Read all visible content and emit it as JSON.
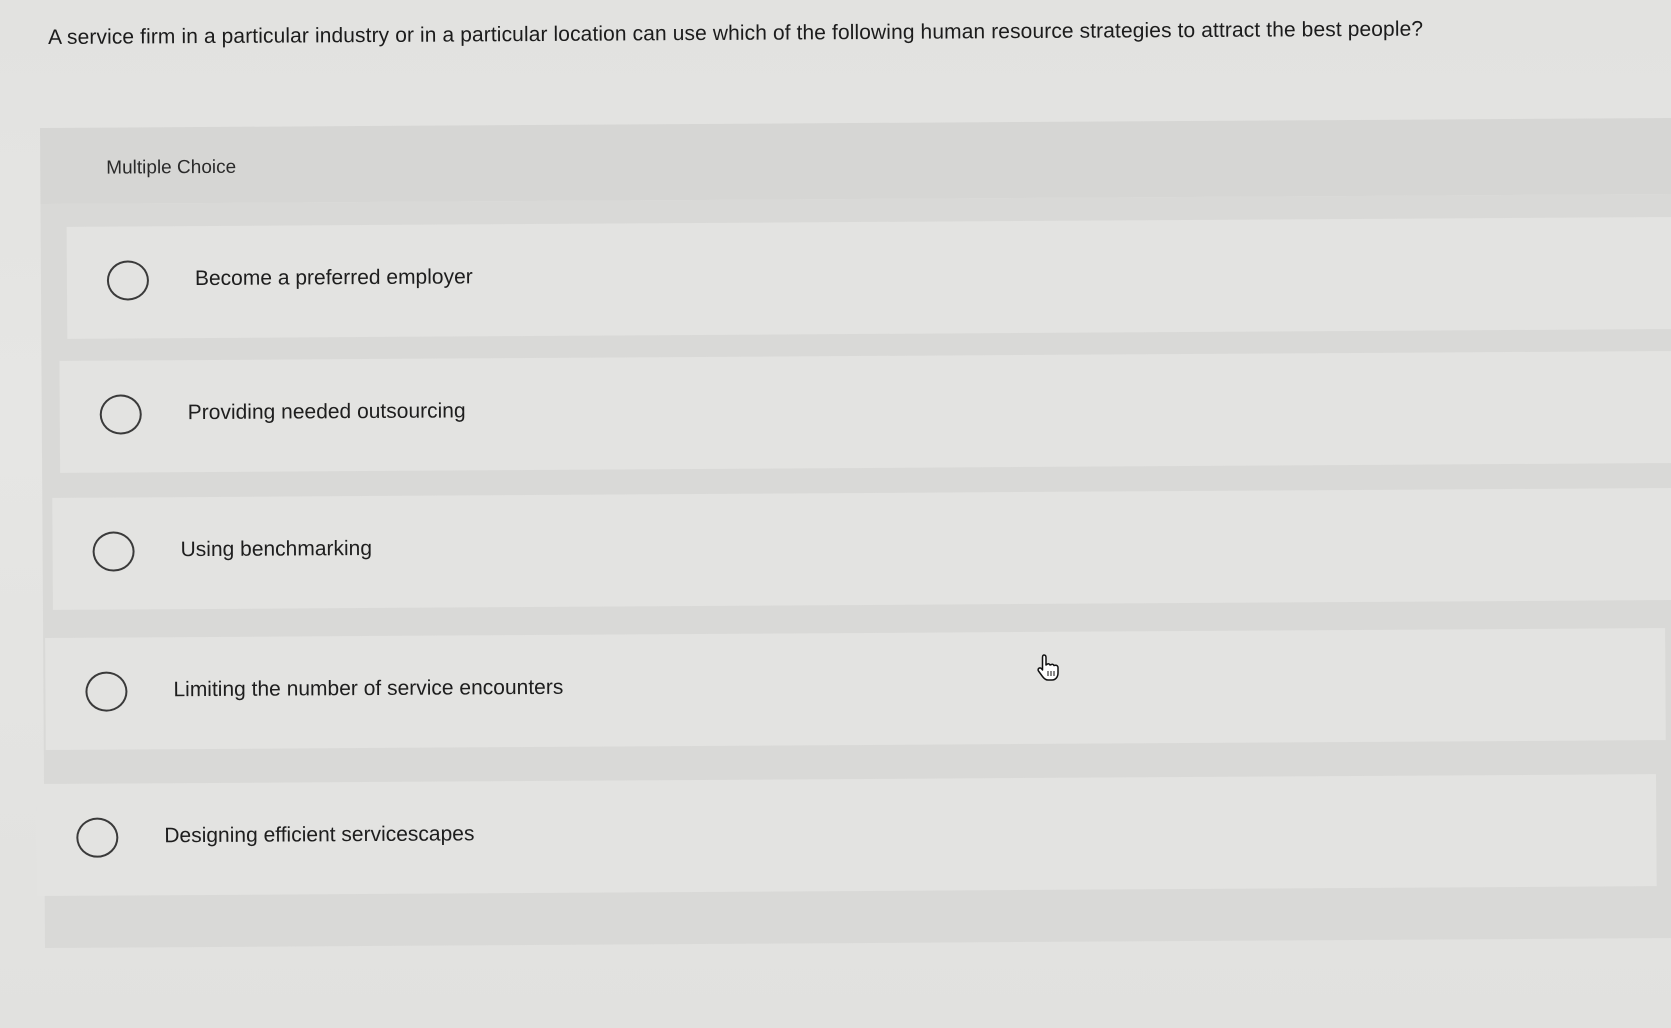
{
  "question": {
    "text": "A service firm in a particular industry or in a particular location can use which of the following human resource strategies to attract the best people?"
  },
  "multiple_choice": {
    "header_label": "Multiple Choice",
    "options": [
      {
        "label": "Become a preferred employer",
        "selected": false
      },
      {
        "label": "Providing needed outsourcing",
        "selected": false
      },
      {
        "label": "Using benchmarking",
        "selected": false
      },
      {
        "label": "Limiting the number of service encounters",
        "selected": false
      },
      {
        "label": "Designing efficient servicescapes",
        "selected": false
      }
    ]
  },
  "cursor": {
    "icon": "hand-pointer-icon"
  }
}
